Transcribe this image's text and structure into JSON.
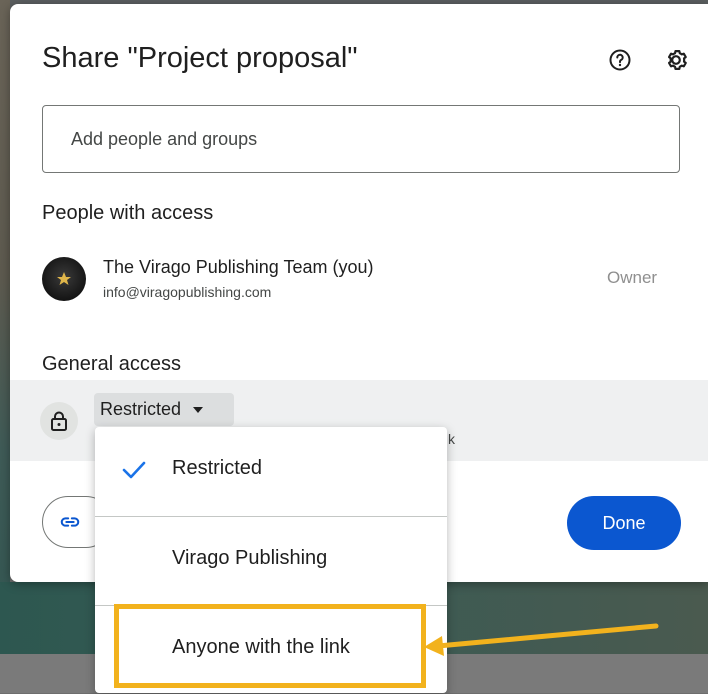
{
  "dialog": {
    "title": "Share \"Project proposal\"",
    "add_people_placeholder": "Add people and groups",
    "people_heading": "People with access",
    "people": [
      {
        "name": "The Virago Publishing Team (you)",
        "email": "info@viragopublishing.com",
        "role": "Owner"
      }
    ],
    "general_heading": "General access",
    "general_access": {
      "selected": "Restricted",
      "description_tail": "k"
    },
    "done_label": "Done"
  },
  "menu": {
    "items": [
      {
        "label": "Restricted",
        "checked": true
      },
      {
        "label": "Virago Publishing",
        "checked": false
      },
      {
        "label": "Anyone with the link",
        "checked": false
      }
    ]
  },
  "colors": {
    "primary": "#0b57d0",
    "highlight": "#f2b21d",
    "row_bg": "#eff0f1"
  },
  "icons": [
    "help-icon",
    "settings-icon",
    "lock-icon",
    "link-icon",
    "checkmark-icon",
    "caret-down-icon"
  ]
}
